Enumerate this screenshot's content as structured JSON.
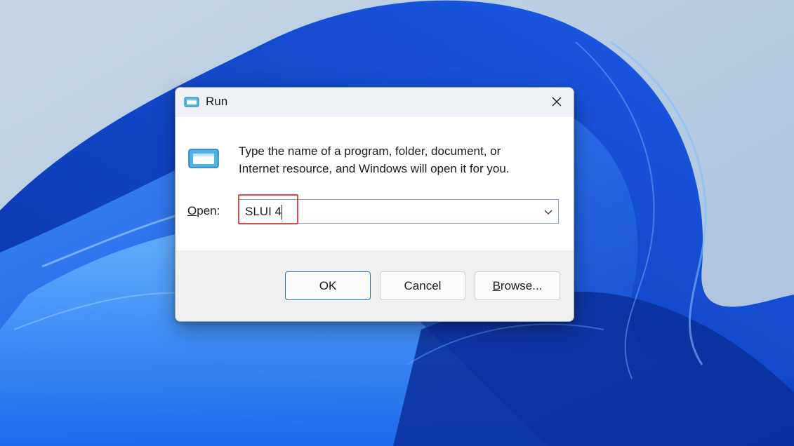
{
  "dialog": {
    "title": "Run",
    "description_line1": "Type the name of a program, folder, document, or",
    "description_line2": "Internet resource, and Windows will open it for you.",
    "open_label_underlined": "O",
    "open_label_rest": "pen:",
    "open_value": "SLUI 4",
    "buttons": {
      "ok": "OK",
      "cancel": "Cancel",
      "browse_underlined": "B",
      "browse_rest": "rowse..."
    }
  },
  "icons": {
    "title": "run-icon",
    "body": "run-icon",
    "close": "close-icon",
    "dropdown": "chevron-down-icon"
  },
  "colors": {
    "highlight_box": "#e04a4a",
    "ok_button_border": "#2c6db8",
    "wallpaper_blue": "#1a63e6"
  }
}
